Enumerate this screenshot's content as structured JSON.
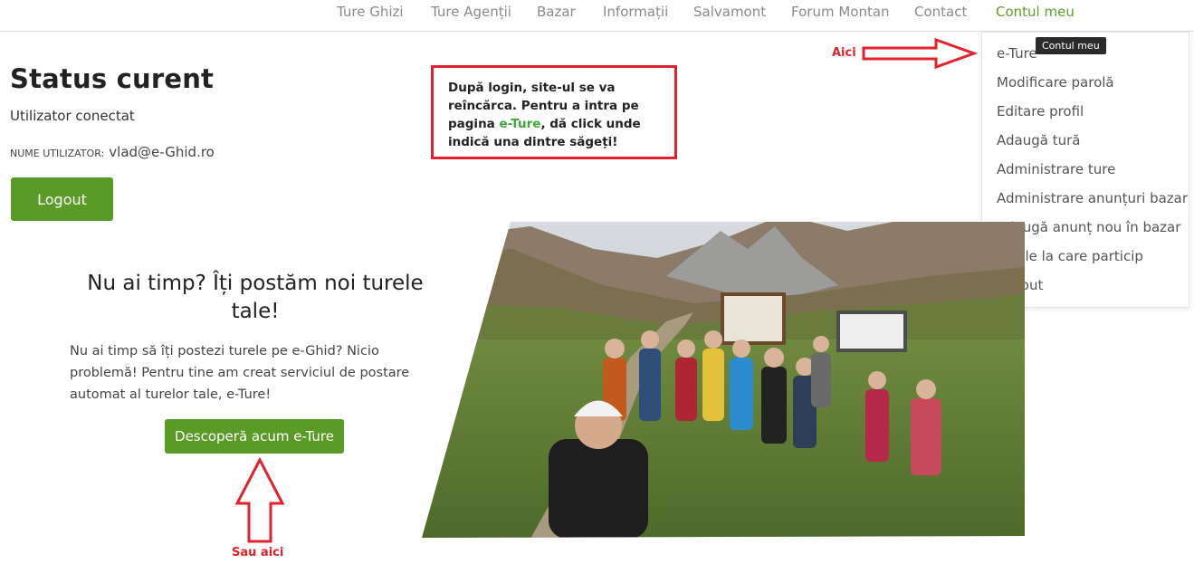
{
  "nav": {
    "items": [
      "Ture Ghizi",
      "Ture Agenții",
      "Bazar",
      "Informații",
      "Salvamont",
      "Forum Montan",
      "Contact",
      "Contul meu"
    ],
    "active": "Contul meu"
  },
  "tooltip": {
    "text": "Contul meu"
  },
  "dropdown": {
    "items": [
      "e-Ture",
      "Modificare parolă",
      "Editare profil",
      "Adaugă tură",
      "Administrare ture",
      "Administrare anunțuri bazar",
      "Adaugă anunț nou în bazar",
      "Turele la care particip",
      "Logout"
    ]
  },
  "annotations": {
    "right_label": "Aici",
    "bottom_label": "Sau aici",
    "color": "#e3212b"
  },
  "status": {
    "title": "Status curent",
    "subtitle": "Utilizator conectat",
    "user_label": "NUME UTILIZATOR:",
    "user_value": "vlad@e-Ghid.ro",
    "logout_label": "Logout"
  },
  "callout": {
    "text_1": "După login, site-ul se va reîncărca. Pentru a intra pe pagina ",
    "link": "e-Ture",
    "text_2": ", dă click unde indică una dintre săgeți!"
  },
  "promo": {
    "title": "Nu ai timp? Îți postăm noi turele tale!",
    "text": "Nu ai timp să îți postezi turele pe e-Ghid? Nicio problemă! Pentru tine am creat serviciul de postare automat al turelor tale, e-Ture!",
    "button_label": "Descoperă acum e-Ture"
  },
  "colors": {
    "brand_green": "#5a9a26",
    "nav_active": "#5f9e2a",
    "link_green": "#3fa637"
  }
}
